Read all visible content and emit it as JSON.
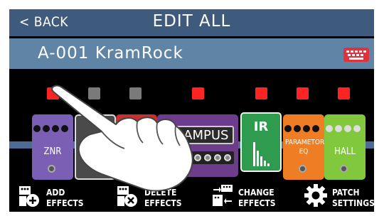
{
  "header": {
    "back_label": "< BACK",
    "title": "EDIT ALL"
  },
  "patch": {
    "name": "A-001 KramRock",
    "keyboard_icon": "keyboard-icon"
  },
  "leds": [
    {
      "state": "on"
    },
    {
      "state": "off"
    },
    {
      "state": "off"
    },
    {
      "state": "on"
    },
    {
      "state": "on"
    },
    {
      "state": "on"
    },
    {
      "state": "on"
    }
  ],
  "effects": [
    {
      "name": "ZNR",
      "color": "#7b5fb5"
    },
    {
      "name": "",
      "color": "#4a4a4a"
    },
    {
      "name": "",
      "color": "#c83030"
    },
    {
      "name": "KRAMPUS",
      "color": "#6e3c8c"
    },
    {
      "name": "IR",
      "color": "#2e9b4e"
    },
    {
      "name": "PARAMETORIC EQ",
      "color": "#ef7d24"
    },
    {
      "name": "HALL",
      "color": "#82c83c"
    }
  ],
  "menu": [
    {
      "label1": "ADD",
      "label2": "EFFECTS",
      "icon": "add-effects-icon"
    },
    {
      "label1": "DELETE",
      "label2": "EFFECTS",
      "icon": "delete-effects-icon"
    },
    {
      "label1": "CHANGE",
      "label2": "EFFECTS",
      "icon": "change-effects-icon"
    },
    {
      "label1": "PATCH",
      "label2": "SETTINGS",
      "icon": "gear-icon"
    }
  ],
  "colors": {
    "header_bg": "#3e5a7c",
    "patchbar_bg": "#5f84a6",
    "led_on": "#ff2424",
    "led_off": "#7a7a7a",
    "signal_line": "#4b6c95"
  }
}
